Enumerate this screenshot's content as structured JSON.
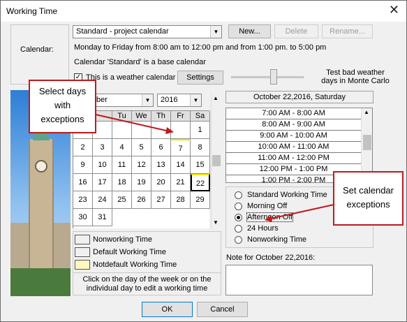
{
  "window": {
    "title": "Working Time",
    "close_glyph": "✕"
  },
  "calendar_section": {
    "label": "Calendar:",
    "selected_calendar": "Standard  - project calendar",
    "new_label": "New...",
    "delete_label": "Delete",
    "rename_label": "Rename...",
    "hours_description": "Monday to Friday from 8:00 am to 12:00 pm and from 1:00 pm. to 5:00 pm",
    "base_note": "Calendar 'Standard' is a base calendar",
    "weather_checkbox_label": "This is a weather calendar",
    "weather_checked": true,
    "settings_label": "Settings",
    "test_weather_line1": "Test bad weather",
    "test_weather_line2": "days in Monte Carlo"
  },
  "month_picker": {
    "month_visible": "ber",
    "year": "2016"
  },
  "weekdays": [
    "Tu",
    "We",
    "Th",
    "Fr",
    "Sa"
  ],
  "grid_rows": [
    [
      "",
      "",
      "",
      "",
      "1"
    ],
    [
      "2",
      "3",
      "4",
      "5",
      "6",
      "7",
      "8"
    ],
    [
      "9",
      "10",
      "11",
      "12",
      "13",
      "14",
      "15"
    ],
    [
      "16",
      "17",
      "18",
      "19",
      "20",
      "21",
      "22"
    ],
    [
      "23",
      "24",
      "25",
      "26",
      "27",
      "28",
      "29"
    ],
    [
      "30",
      "31"
    ]
  ],
  "legend": {
    "nonworking": "Nonworking Time",
    "default_working": "Default Working Time",
    "nondefault_working": "Notdefault Working Time",
    "hint_line1": "Click on the day of the week or on the",
    "hint_line2": "individual day to edit a working time",
    "nonworking_color": "#ffffff",
    "default_color": "#ffffff",
    "nondefault_color": "#fff7c0"
  },
  "selected_date_header": "October 22,2016, Saturday",
  "time_slots": [
    "7:00 AM  -  8:00 AM",
    "8:00 AM  -  9:00 AM",
    "9:00 AM  -  10:00 AM",
    "10:00 AM  -  11:00 AM",
    "11:00 AM  -  12:00 PM",
    "12:00 PM  -  1:00 PM",
    "1:00 PM  -  2:00 PM"
  ],
  "exception_options": [
    {
      "label": "Standard Working Time",
      "checked": false
    },
    {
      "label": "Morning Off",
      "checked": false
    },
    {
      "label": "Afternoon Off",
      "checked": true
    },
    {
      "label": "24 Hours",
      "checked": false
    },
    {
      "label": "Nonworking Time",
      "checked": false
    }
  ],
  "note_label": "Note for October 22,2016:",
  "ok_label": "OK",
  "cancel_label": "Cancel",
  "callouts": {
    "select_days": "Select days with exceptions",
    "select_days_l1": "Select days",
    "select_days_l2": "with",
    "select_days_l3": "exceptions",
    "set_exceptions_l1": "Set calendar",
    "set_exceptions_l2": "exceptions"
  },
  "colors": {
    "accent_red": "#c0191d",
    "nondefault_yellow": "#f5e400"
  }
}
